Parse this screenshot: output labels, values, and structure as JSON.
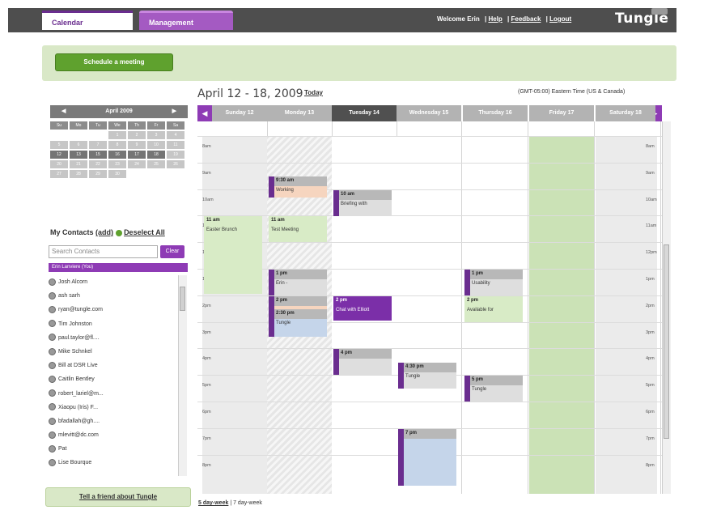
{
  "header": {
    "tabs": [
      "Calendar",
      "Management"
    ],
    "welcome": "Welcome Erin",
    "links": [
      "Help",
      "Feedback",
      "Logout"
    ],
    "logo": "Tungle"
  },
  "actions": {
    "schedule": "Schedule a meeting"
  },
  "week": {
    "title": "April 12 - 18, 2009",
    "today": "Today",
    "timezone": "(GMT-05:00) Eastern Time (US & Canada)"
  },
  "days": [
    "Sunday 12",
    "Monday 13",
    "Tuesday 14",
    "Wednesday 15",
    "Thursday 16",
    "Friday 17",
    "Saturday 18"
  ],
  "times": [
    "8am",
    "9am",
    "10am",
    "11am",
    "12pm",
    "1pm",
    "2pm",
    "3pm",
    "4pm",
    "5pm",
    "6pm",
    "7pm",
    "8pm"
  ],
  "mini_calendar": {
    "month": "April 2009",
    "prev": "◀",
    "next": "▶",
    "weekdays": [
      "Su",
      "Mo",
      "Tu",
      "We",
      "Th",
      "Fr",
      "Sa"
    ],
    "weeks": [
      [
        "",
        "",
        "",
        "1",
        "2",
        "3",
        "4"
      ],
      [
        "5",
        "6",
        "7",
        "8",
        "9",
        "10",
        "11"
      ],
      [
        "12",
        "13",
        "14",
        "15",
        "16",
        "17",
        "18"
      ],
      [
        "19",
        "20",
        "21",
        "22",
        "23",
        "24",
        "25"
      ],
      [
        "26",
        "27",
        "28",
        "29",
        "30",
        "",
        ""
      ]
    ]
  },
  "contacts": {
    "title": "My Contacts",
    "add": "(add)",
    "deselect": "Deselect All",
    "search_placeholder": "Search Contacts",
    "clear": "Clear",
    "me": "Erin Lanviere (You)",
    "list": [
      "Josh Alcorn",
      "ash sarh",
      "ryan@tungle.com",
      "Tim Johnston",
      "paul.taylor@fl....",
      "Mike Schnkel",
      "Bill at DSR Live",
      "Caitlin Bentley",
      "robert_lariel@m...",
      "Xiaopu (Iris) F...",
      "bfadallah@gh....",
      "mlevitt@dc.com",
      "Pat",
      "Lise Bourque"
    ]
  },
  "events": [
    {
      "day": 1,
      "time": "9:30 am",
      "title": "Working",
      "style": "peach"
    },
    {
      "day": 2,
      "time": "10 am",
      "title": "Briefing with",
      "style": "gray"
    },
    {
      "day": 0,
      "time": "11 am",
      "title": "Easter Brunch",
      "style": "green"
    },
    {
      "day": 1,
      "time": "11 am",
      "title": "Test Meeting",
      "style": "green"
    },
    {
      "day": 1,
      "time": "1 pm",
      "title": "Erin -",
      "style": "gray"
    },
    {
      "day": 4,
      "time": "1 pm",
      "title": "Usability",
      "style": "gray"
    },
    {
      "day": 1,
      "time": "2 pm",
      "title": "",
      "style": "peach"
    },
    {
      "day": 2,
      "time": "2 pm",
      "title": "Chat with Elliott",
      "style": "solid"
    },
    {
      "day": 4,
      "time": "2 pm",
      "title": "Available for",
      "style": "green"
    },
    {
      "day": 1,
      "time": "2:30 pm",
      "title": "Tungle",
      "style": "blue"
    },
    {
      "day": 2,
      "time": "4 pm",
      "title": "",
      "style": "gray"
    },
    {
      "day": 3,
      "time": "4:30 pm",
      "title": "Tungle",
      "style": "gray"
    },
    {
      "day": 4,
      "time": "5 pm",
      "title": "Tungle",
      "style": "gray"
    },
    {
      "day": 3,
      "time": "7 pm",
      "title": "",
      "style": "blue"
    }
  ],
  "footer": {
    "tell_friend": "Tell a friend about Tungle",
    "five_day": "5 day-week",
    "sep": "|",
    "seven_day": "7 day-week"
  }
}
